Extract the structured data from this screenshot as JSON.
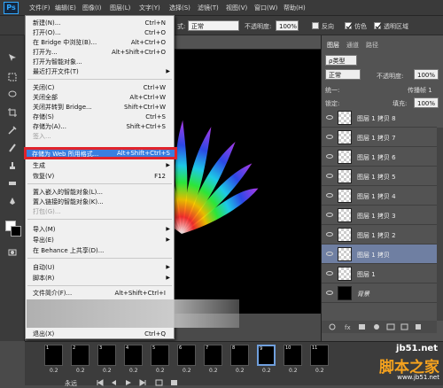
{
  "app": {
    "logo": "Ps"
  },
  "menubar": [
    {
      "label": "文件(F)"
    },
    {
      "label": "编辑(E)"
    },
    {
      "label": "图像(I)"
    },
    {
      "label": "图层(L)"
    },
    {
      "label": "文字(Y)"
    },
    {
      "label": "选择(S)"
    },
    {
      "label": "滤镜(T)"
    },
    {
      "label": "视图(V)"
    },
    {
      "label": "窗口(W)"
    },
    {
      "label": "帮助(H)"
    }
  ],
  "options": {
    "mode_value": "正常",
    "opacity_label": "不透明度:",
    "opacity_value": "100%",
    "reverse_label": "反向",
    "dither_label": "仿色",
    "transparency_label": "透明区域",
    "mode_prefix": "式:"
  },
  "file_menu": {
    "items": [
      {
        "label": "新建(N)...",
        "shortcut": "Ctrl+N"
      },
      {
        "label": "打开(O)...",
        "shortcut": "Ctrl+O"
      },
      {
        "label": "在 Bridge 中浏览(B)...",
        "shortcut": "Alt+Ctrl+O"
      },
      {
        "label": "打开为...",
        "shortcut": "Alt+Shift+Ctrl+O"
      },
      {
        "label": "打开为智能对象...",
        "shortcut": ""
      },
      {
        "label": "最近打开文件(T)",
        "shortcut": ""
      },
      {
        "label": "关闭(C)",
        "shortcut": "Ctrl+W"
      },
      {
        "label": "关闭全部",
        "shortcut": "Alt+Ctrl+W"
      },
      {
        "label": "关闭并转到 Bridge...",
        "shortcut": "Shift+Ctrl+W"
      },
      {
        "label": "存储(S)",
        "shortcut": "Ctrl+S"
      },
      {
        "label": "存储为(A)...",
        "shortcut": "Shift+Ctrl+S"
      },
      {
        "label": "签入...",
        "shortcut": ""
      },
      {
        "label": "存储为 Web 所用格式...",
        "shortcut": "Alt+Shift+Ctrl+S"
      },
      {
        "label": "生成",
        "shortcut": ""
      },
      {
        "label": "恢复(V)",
        "shortcut": "F12"
      },
      {
        "label": "置入嵌入的智能对象(L)...",
        "shortcut": ""
      },
      {
        "label": "置入链接的智能对象(K)...",
        "shortcut": ""
      },
      {
        "label": "打包(G)...",
        "shortcut": ""
      },
      {
        "label": "导入(M)",
        "shortcut": ""
      },
      {
        "label": "导出(E)",
        "shortcut": ""
      },
      {
        "label": "在 Behance 上共享(D)...",
        "shortcut": ""
      },
      {
        "label": "自动(U)",
        "shortcut": ""
      },
      {
        "label": "脚本(R)",
        "shortcut": ""
      },
      {
        "label": "文件简介(F)...",
        "shortcut": "Alt+Shift+Ctrl+I"
      },
      {
        "label": "退出(X)",
        "shortcut": "Ctrl+Q"
      }
    ]
  },
  "layers_panel": {
    "tabs": [
      "图层",
      "通道",
      "路径"
    ],
    "filter_label": "ρ类型",
    "blend_mode": "正常",
    "opacity_label": "不透明度:",
    "opacity_value": "100%",
    "unify_label": "统一:",
    "propagate_label": "传播帧 1",
    "lock_label": "锁定:",
    "fill_label": "填充:",
    "fill_value": "100%",
    "layers": [
      {
        "name": "图层 1 拷贝 8"
      },
      {
        "name": "图层 1 拷贝 7"
      },
      {
        "name": "图层 1 拷贝 6"
      },
      {
        "name": "图层 1 拷贝 5"
      },
      {
        "name": "图层 1 拷贝 4"
      },
      {
        "name": "图层 1 拷贝 3"
      },
      {
        "name": "图层 1 拷贝 2"
      },
      {
        "name": "图层 1 拷贝"
      },
      {
        "name": "图层 1"
      },
      {
        "name": "背景"
      }
    ]
  },
  "timeline": {
    "frames": [
      {
        "num": "1",
        "duration": "0.2"
      },
      {
        "num": "2",
        "duration": "0.2"
      },
      {
        "num": "3",
        "duration": "0.2"
      },
      {
        "num": "4",
        "duration": "0.2"
      },
      {
        "num": "5",
        "duration": "0.2"
      },
      {
        "num": "6",
        "duration": "0.2"
      },
      {
        "num": "7",
        "duration": "0.2"
      },
      {
        "num": "8",
        "duration": "0.2"
      },
      {
        "num": "9",
        "duration": "0.2"
      },
      {
        "num": "10",
        "duration": "0.2"
      },
      {
        "num": "11",
        "duration": "0.2"
      }
    ],
    "loop_label": "永远"
  },
  "watermark": {
    "site": "jb51.net",
    "brand": "脚本之家",
    "url": "www.jb51.net"
  }
}
